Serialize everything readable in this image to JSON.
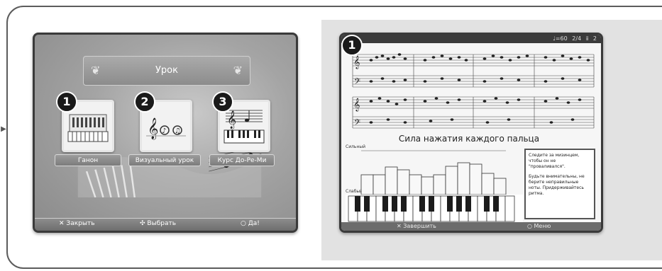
{
  "left_screen": {
    "title": "Урок",
    "modes": [
      {
        "number": "1",
        "label": "Ганон",
        "icon": "piano-keys-icon"
      },
      {
        "number": "2",
        "label": "Визуальный урок",
        "icon": "music-notes-icon"
      },
      {
        "number": "3",
        "label": "Курс До-Ре-Ми",
        "icon": "score-keyboard-icon"
      }
    ],
    "bottom_bar": {
      "close_glyph": "✕",
      "close_label": "Закрыть",
      "select_glyph": "✣",
      "select_label": "Выбрать",
      "ok_glyph": "○",
      "ok_label": "Да!"
    }
  },
  "right_screen": {
    "badge": "1",
    "top_info": "♩=60  2/4  ⅱ  2",
    "section_title": "Сила нажатия каждого пальца",
    "row_labels": {
      "strong": "Сильный",
      "weak": "Слабый"
    },
    "hint_paragraphs": [
      "Следите за мизинцем, чтобы он не \"проваливался\".",
      "Будьте внимательны, не берите неправильные ноты. Придерживайтесь ритма."
    ],
    "bar_values": [
      0.55,
      0.55,
      0.78,
      0.7,
      0.55,
      0.5,
      0.55,
      0.8,
      0.9,
      0.85,
      0.6,
      0.45
    ],
    "bottom_bar": {
      "finish_glyph": "✕",
      "finish_label": "Завершить",
      "menu_glyph": "○",
      "menu_label": "Меню"
    }
  }
}
